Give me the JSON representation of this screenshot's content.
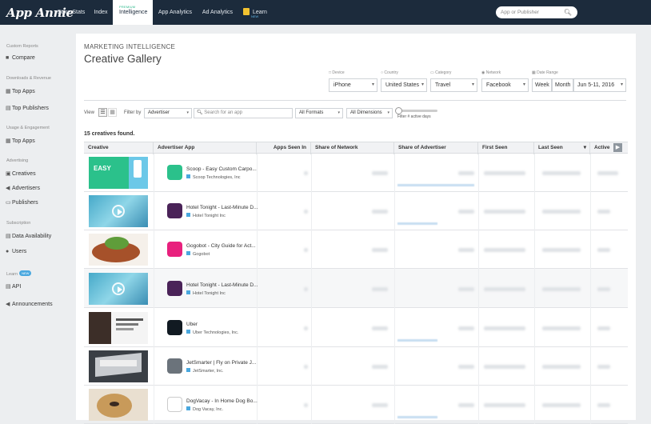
{
  "header": {
    "logo": "App Annie",
    "nav": [
      {
        "label": "Store Stats"
      },
      {
        "label": "Index"
      },
      {
        "label": "Intelligence",
        "sup": "PREMIUM"
      },
      {
        "label": "App Analytics"
      },
      {
        "label": "Ad Analytics"
      },
      {
        "label": "Learn",
        "sup": "NEW"
      }
    ],
    "search_placeholder": "App or Publisher"
  },
  "sidebar": {
    "sections": [
      {
        "heading": "Custom Reports",
        "items": [
          {
            "label": "Compare",
            "icon": "binoculars-icon"
          }
        ]
      },
      {
        "heading": "Downloads & Revenue",
        "items": [
          {
            "label": "Top Apps",
            "icon": "grid-icon"
          },
          {
            "label": "Top Publishers",
            "icon": "document-icon"
          }
        ]
      },
      {
        "heading": "Usage & Engagement",
        "items": [
          {
            "label": "Top Apps",
            "icon": "grid-icon"
          }
        ]
      },
      {
        "heading": "Advertising",
        "items": [
          {
            "label": "Creatives",
            "icon": "image-icon"
          },
          {
            "label": "Advertisers",
            "icon": "megaphone-icon"
          },
          {
            "label": "Publishers",
            "icon": "monitor-icon"
          }
        ]
      },
      {
        "heading": "Subscription",
        "items": [
          {
            "label": "Data Availability",
            "icon": "document-icon"
          },
          {
            "label": "Users",
            "icon": "users-icon"
          }
        ]
      },
      {
        "heading": "Learn",
        "badge": "NEW",
        "items": [
          {
            "label": "API",
            "icon": "document-icon"
          },
          {
            "label": "Announcements",
            "icon": "megaphone-icon"
          }
        ]
      }
    ]
  },
  "page": {
    "breadcrumb": "MARKETING INTELLIGENCE",
    "title": "Creative Gallery"
  },
  "filters": {
    "device": {
      "label": "Device",
      "value": "iPhone"
    },
    "country": {
      "label": "Country",
      "value": "United States"
    },
    "category": {
      "label": "Category",
      "value": "Travel"
    },
    "network": {
      "label": "Network",
      "value": "Facebook"
    },
    "date_range": {
      "label": "Date Range",
      "week": "Week",
      "month": "Month",
      "value": "Jun 5-11, 2016"
    }
  },
  "controls": {
    "view_label": "View",
    "filter_by_label": "Filter by",
    "filter_by_value": "Advertiser",
    "search_placeholder": "Search for an app",
    "formats": "All Formats",
    "dimensions": "All Dimensions",
    "active_days": "Filter # active days"
  },
  "results_count": "15 creatives found.",
  "table": {
    "columns": [
      "Creative",
      "Advertiser App",
      "Apps Seen In",
      "Share of Network",
      "Share of Advertiser",
      "First Seen",
      "Last Seen",
      "Active"
    ],
    "rows": [
      {
        "name": "Scoop - Easy Custom Carpo...",
        "company": "Scoop Technologies, Inc",
        "icon_color": "#2bc18b",
        "thumb": "scoop",
        "thumb_text": "EASY"
      },
      {
        "name": "Hotel Tonight - Last-Minute D...",
        "company": "Hotel Tonight Inc",
        "icon_color": "#4a2358",
        "thumb": "video"
      },
      {
        "name": "Gogobot - City Guide for Act...",
        "company": "Gogobot",
        "icon_color": "#e8207d",
        "thumb": "food"
      },
      {
        "name": "Hotel Tonight - Last-Minute D...",
        "company": "Hotel Tonight Inc",
        "icon_color": "#4a2358",
        "thumb": "video"
      },
      {
        "name": "Uber",
        "company": "Uber Technologies, Inc.",
        "icon_color": "#111a22",
        "thumb": "uber"
      },
      {
        "name": "JetSmarter | Fly on Private J...",
        "company": "JetSmarter, Inc.",
        "icon_color": "#6b737b",
        "thumb": "jet"
      },
      {
        "name": "DogVacay - In Home Dog Bo...",
        "company": "Dog Vacay, Inc.",
        "icon_color": "#ffffff",
        "thumb": "dog"
      }
    ]
  },
  "colors": {
    "topbar": "#1c2b3c",
    "accent_green": "#28b889",
    "accent_blue": "#4aa8df"
  }
}
